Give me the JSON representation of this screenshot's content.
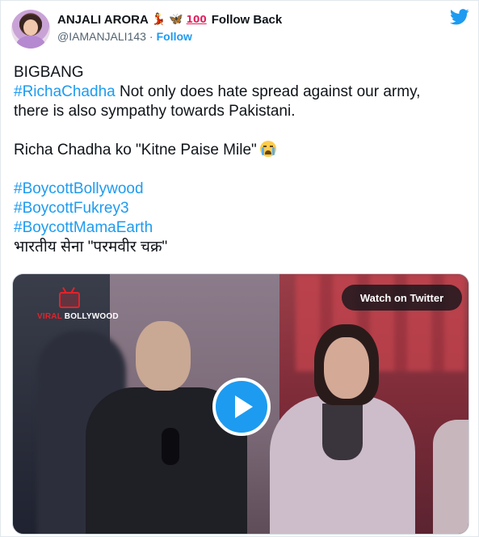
{
  "author": {
    "display_name": "ANJALI ARORA",
    "emojis": [
      "dancer-emoji",
      "butterfly-emoji",
      "hundred-points-emoji"
    ],
    "follow_back_label": "Follow Back",
    "handle": "@IAMANJALI143",
    "separator": "·",
    "follow_label": "Follow"
  },
  "tweet": {
    "line1": "BIGBANG",
    "line2_hashtag": "#RichaChadha",
    "line2_rest": " Not only does hate spread against our army,",
    "line3": "there is also sympathy towards Pakistani.",
    "line4": " Richa Chadha ko \"Kitne Paise Mile\"",
    "hashtags": [
      "#BoycottBollywood",
      "#BoycottFukrey3",
      "#BoycottMamaEarth"
    ],
    "line_last": "भारतीय सेना \"परमवीर चक्र\""
  },
  "media": {
    "watermark_brand_a": "VIRAL",
    "watermark_brand_b": " BOLLYWOOD",
    "watch_label": "Watch on Twitter"
  },
  "colors": {
    "accent": "#1d9bf0",
    "text": "#0f1419",
    "secondary": "#536471"
  },
  "icons": [
    "twitter-bird-icon",
    "play-icon",
    "loudly-crying-face-emoji",
    "tv-logo-icon"
  ]
}
